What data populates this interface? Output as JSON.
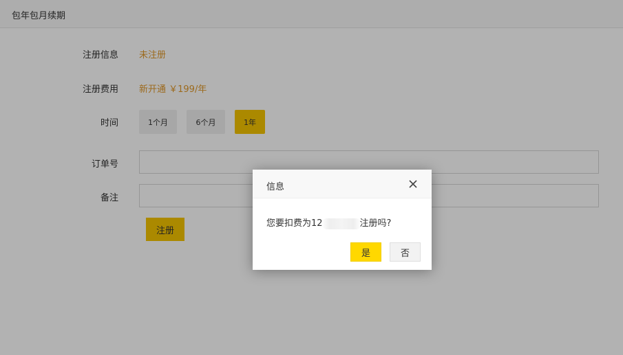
{
  "header": {
    "title": "包年包月续期"
  },
  "form": {
    "reg_info_label": "注册信息",
    "reg_info_value": "未注册",
    "reg_fee_label": "注册费用",
    "reg_fee_value": "新开通 ￥199/年",
    "time_label": "时间",
    "durations": [
      {
        "label": "1个月",
        "selected": false
      },
      {
        "label": "6个月",
        "selected": false
      },
      {
        "label": "1年",
        "selected": true
      }
    ],
    "order_label": "订单号",
    "order_value": "",
    "remark_label": "备注",
    "remark_value": "",
    "submit_label": "注册"
  },
  "dialog": {
    "title": "信息",
    "message_prefix": "您要扣费为12",
    "message_suffix": "注册吗?",
    "yes_label": "是",
    "no_label": "否",
    "close_icon": "close-icon"
  },
  "colors": {
    "accent": "#f5c400",
    "orange_text": "#e0982a",
    "overlay": "rgba(0,0,0,0.30)"
  }
}
